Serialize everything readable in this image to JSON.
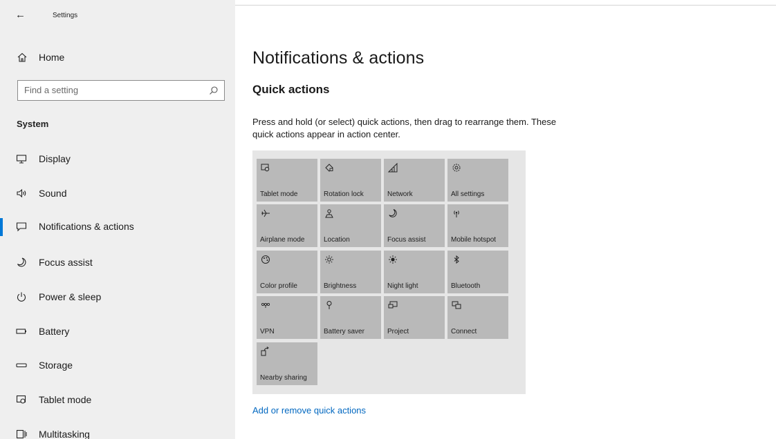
{
  "window": {
    "title": "Settings",
    "back_icon": "back-arrow-icon"
  },
  "sidebar": {
    "home": {
      "label": "Home",
      "icon": "home-icon"
    },
    "search": {
      "placeholder": "Find a setting",
      "icon": "search-icon"
    },
    "section": "System",
    "items": [
      {
        "label": "Display",
        "icon": "display-icon"
      },
      {
        "label": "Sound",
        "icon": "speaker-icon"
      },
      {
        "label": "Notifications & actions",
        "icon": "notification-icon",
        "active": true
      },
      {
        "label": "Focus assist",
        "icon": "moon-icon"
      },
      {
        "label": "Power & sleep",
        "icon": "power-icon"
      },
      {
        "label": "Battery",
        "icon": "battery-icon"
      },
      {
        "label": "Storage",
        "icon": "storage-icon"
      },
      {
        "label": "Tablet mode",
        "icon": "tablet-mode-icon"
      },
      {
        "label": "Multitasking",
        "icon": "multitasking-icon"
      }
    ]
  },
  "main": {
    "title": "Notifications & actions",
    "quick_actions": {
      "heading": "Quick actions",
      "description": "Press and hold (or select) quick actions, then drag to rearrange them. These quick actions appear in action center.",
      "tiles": [
        {
          "label": "Tablet mode",
          "icon": "tablet-mode-icon"
        },
        {
          "label": "Rotation lock",
          "icon": "rotation-lock-icon"
        },
        {
          "label": "Network",
          "icon": "network-icon"
        },
        {
          "label": "All settings",
          "icon": "gear-icon"
        },
        {
          "label": "Airplane mode",
          "icon": "airplane-icon"
        },
        {
          "label": "Location",
          "icon": "location-icon"
        },
        {
          "label": "Focus assist",
          "icon": "moon-icon"
        },
        {
          "label": "Mobile hotspot",
          "icon": "hotspot-icon"
        },
        {
          "label": "Color profile",
          "icon": "color-profile-icon"
        },
        {
          "label": "Brightness",
          "icon": "brightness-icon"
        },
        {
          "label": "Night light",
          "icon": "night-light-icon"
        },
        {
          "label": "Bluetooth",
          "icon": "bluetooth-icon"
        },
        {
          "label": "VPN",
          "icon": "vpn-icon"
        },
        {
          "label": "Battery saver",
          "icon": "battery-saver-icon"
        },
        {
          "label": "Project",
          "icon": "project-icon"
        },
        {
          "label": "Connect",
          "icon": "connect-icon"
        },
        {
          "label": "Nearby sharing",
          "icon": "nearby-sharing-icon"
        }
      ],
      "link": "Add or remove quick actions"
    }
  },
  "colors": {
    "accent": "#0078d7",
    "link": "#0067c0",
    "sidebar_bg": "#efefef",
    "tile_bg": "#b9b9b9",
    "panel_bg": "#e6e6e6"
  }
}
